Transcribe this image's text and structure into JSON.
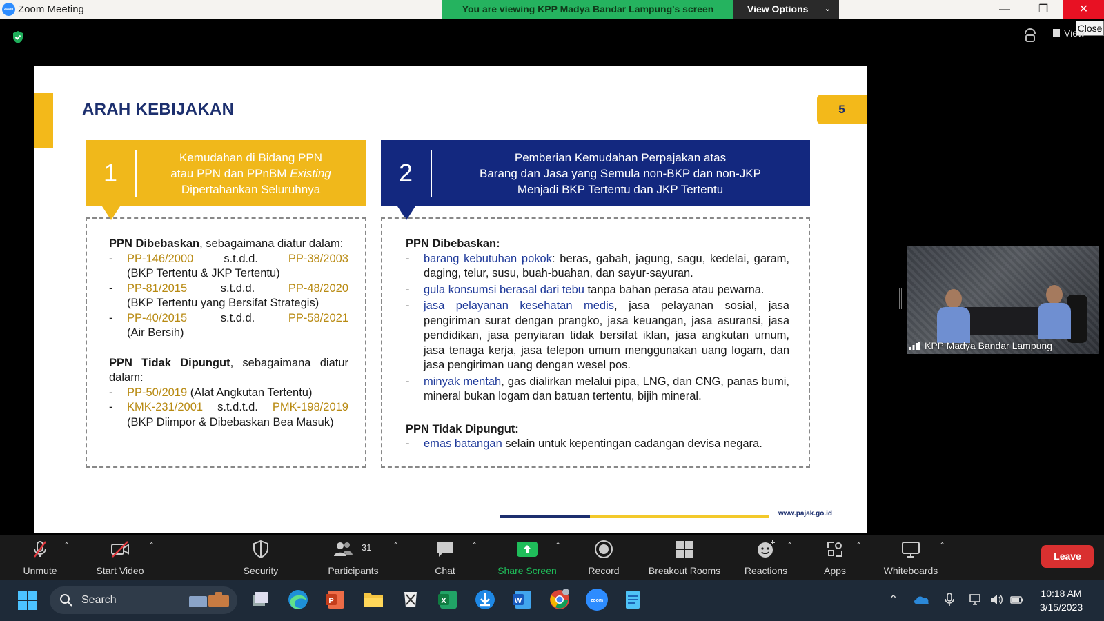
{
  "window": {
    "title": "Zoom Meeting",
    "app_logo_text": "zoom",
    "share_banner": "You are viewing KPP Madya Bandar Lampung's screen",
    "view_options_label": "View Options",
    "close_tooltip": "Close",
    "view_button_label": "View"
  },
  "slide": {
    "title": "ARAH KEBIJAKAN",
    "page_number": "5",
    "footer_url": "www.pajak.go.id",
    "col1": {
      "number": "1",
      "header_line1": "Kemudahan di Bidang PPN",
      "header_line2_prefix": "atau PPN dan PPnBM ",
      "header_line2_italic": "Existing",
      "header_line3": "Dipertahankan Seluruhnya",
      "sec1_bold": "PPN Dibebaskan",
      "sec1_rest": ", sebagaimana diatur dalam:",
      "items": [
        {
          "dash": "-",
          "from": "PP-146/2000",
          "mid": "s.t.d.d.",
          "to": "PP-38/2003",
          "note": "(BKP Tertentu & JKP Tertentu)"
        },
        {
          "dash": "-",
          "from": "PP-81/2015",
          "mid": "s.t.d.d.",
          "to": "PP-48/2020",
          "note": "(BKP Tertentu yang Bersifat Strategis)"
        },
        {
          "dash": "-",
          "from": "PP-40/2015",
          "mid": "s.t.d.d.",
          "to": "PP-58/2021",
          "note": "(Air Bersih)"
        }
      ],
      "sec2_bold": "PPN Tidak Dipungut",
      "sec2_rest": ", sebagaimana diatur dalam:",
      "items2": [
        {
          "dash": "-",
          "ref": "PP-50/2019",
          "rest": " (Alat Angkutan Tertentu)"
        },
        {
          "dash": "-",
          "from": "KMK-231/2001",
          "mid": "s.t.d.t.d.",
          "to": "PMK-198/2019",
          "note": "(BKP Diimpor & Dibebaskan Bea Masuk)"
        }
      ]
    },
    "col2": {
      "number": "2",
      "header_line1": "Pemberian Kemudahan Perpajakan atas",
      "header_line2": "Barang dan Jasa yang Semula non-BKP dan non-JKP",
      "header_line3": "Menjadi BKP Tertentu dan JKP Tertentu",
      "sec1_title": "PPN Dibebaskan:",
      "items": [
        {
          "dash": "-",
          "hl": "barang kebutuhan pokok",
          "rest": ": beras, gabah, jagung, sagu, kedelai, garam, daging, telur, susu, buah-buahan, dan sayur-sayuran."
        },
        {
          "dash": "-",
          "hl": "gula konsumsi berasal dari tebu",
          "rest": " tanpa bahan perasa atau pewarna."
        },
        {
          "dash": "-",
          "hl": "jasa pelayanan kesehatan medis",
          "rest": ", jasa pelayanan sosial, jasa pengiriman surat dengan prangko, jasa keuangan, jasa asuransi, jasa pendidikan, jasa penyiaran tidak bersifat iklan, jasa angkutan umum, jasa tenaga kerja, jasa telepon umum menggunakan uang logam, dan jasa pengiriman uang dengan wesel pos."
        },
        {
          "dash": "-",
          "hl": "minyak mentah",
          "rest": ", gas dialirkan melalui pipa, LNG, dan CNG, panas bumi, mineral bukan logam dan batuan tertentu, bijih mineral."
        }
      ],
      "sec2_title": "PPN Tidak Dipungut:",
      "items2": [
        {
          "dash": "-",
          "hl": "emas batangan",
          "rest": " selain untuk kepentingan cadangan devisa negara."
        }
      ]
    }
  },
  "participant": {
    "name": "KPP Madya Bandar Lampung"
  },
  "toolbar": {
    "unmute": "Unmute",
    "start_video": "Start Video",
    "security": "Security",
    "participants": "Participants",
    "participant_count": "31",
    "chat": "Chat",
    "share_screen": "Share Screen",
    "record": "Record",
    "breakout_rooms": "Breakout Rooms",
    "reactions": "Reactions",
    "apps": "Apps",
    "whiteboards": "Whiteboards",
    "leave": "Leave"
  },
  "taskbar": {
    "search_label": "Search",
    "zoom_app_text": "zoom",
    "time": "10:18 AM",
    "date": "3/15/2023"
  },
  "colors": {
    "slide_gold": "#f0b81b",
    "slide_navy": "#13287f",
    "share_green": "#25b35f",
    "leave_red": "#d93030",
    "close_red": "#e81123"
  }
}
